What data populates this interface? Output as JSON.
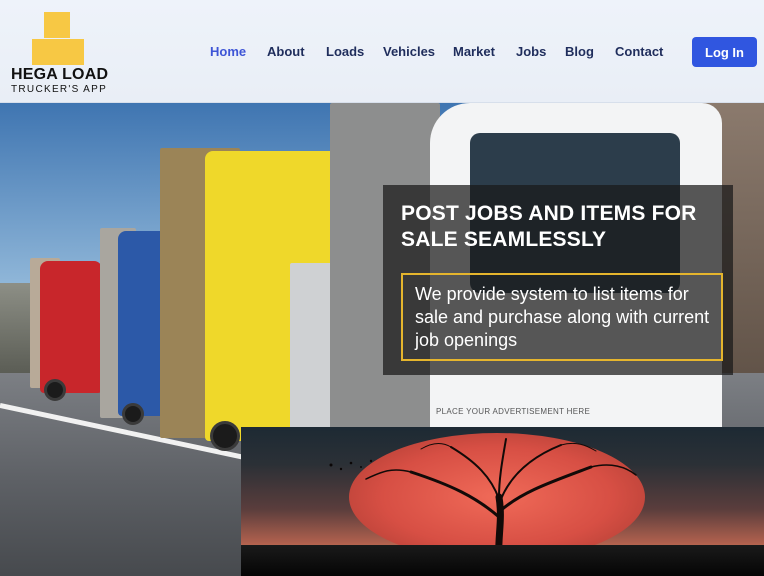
{
  "brand": {
    "name": "HEGA LOAD",
    "tagline": "TRUCKER'S APP"
  },
  "nav": {
    "items": [
      {
        "label": "Home",
        "active": true
      },
      {
        "label": "About"
      },
      {
        "label": "Loads"
      },
      {
        "label": "Vehicles"
      },
      {
        "label": "Market"
      },
      {
        "label": "Jobs"
      },
      {
        "label": "Blog"
      },
      {
        "label": "Contact"
      }
    ],
    "login_label": "Log In"
  },
  "hero": {
    "title": "POST JOBS AND ITEMS FOR SALE SEAMLESSLY",
    "description": "We provide system to list items for sale and purchase along with current job openings",
    "ad_caption": "PLACE YOUR ADVERTISEMENT HERE"
  },
  "colors": {
    "accent": "#3056e0",
    "nav_active": "#3e55d6",
    "nav_text": "#1f2d5c",
    "logo_yellow": "#f7c844",
    "frame_yellow": "#e5b52d"
  }
}
